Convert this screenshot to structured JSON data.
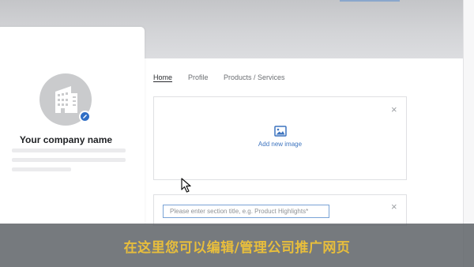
{
  "company": {
    "name": "Your company name"
  },
  "tabs": [
    {
      "label": "Home",
      "active": true
    },
    {
      "label": "Profile",
      "active": false
    },
    {
      "label": "Products / Services",
      "active": false
    }
  ],
  "image_block": {
    "add_label": "Add new image",
    "close_symbol": "×"
  },
  "section_block": {
    "title_placeholder": "Please enter section title, e.g. Product Highlights*",
    "title_value": "",
    "close_symbol": "×"
  },
  "subtitle": "在这里您可以编辑/管理公司推广网页",
  "icons": {
    "avatar": "building-icon",
    "edit": "pencil-icon",
    "image": "image-icon",
    "close": "close-icon",
    "cursor": "mouse-pointer-icon"
  },
  "colors": {
    "accent": "#3d74bf",
    "edit_badge": "#2f6ec5",
    "subtitle_text": "#e8be3c",
    "subtitle_band": "#5c6065"
  }
}
